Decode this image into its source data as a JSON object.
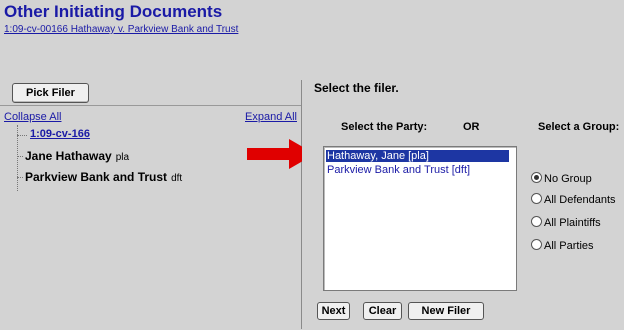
{
  "header": {
    "title": "Other Initiating Documents",
    "case_link": "1:09-cv-00166 Hathaway v. Parkview Bank and Trust"
  },
  "left_panel": {
    "pick_filer_label": "Pick Filer",
    "collapse_all": "Collapse All",
    "expand_all": "Expand All",
    "tree": {
      "case": "1:09-cv-166",
      "parties": [
        {
          "name": "Jane Hathaway",
          "role": "pla"
        },
        {
          "name": "Parkview Bank and Trust",
          "role": "dft"
        }
      ]
    }
  },
  "right_panel": {
    "title": "Select the filer.",
    "party_label": "Select the Party:",
    "or_label": "OR",
    "group_label": "Select a Group:",
    "party_options": [
      "Hathaway, Jane  [pla]",
      "Parkview Bank and Trust  [dft]"
    ],
    "selected_party_index": 0,
    "groups": [
      "No Group",
      "All Defendants",
      "All Plaintiffs",
      "All Parties"
    ],
    "selected_group": "No Group",
    "buttons": {
      "next": "Next",
      "clear": "Clear",
      "new_filer": "New Filer"
    }
  },
  "colors": {
    "link": "#1a1aa6",
    "selection": "#1d36a3",
    "arrow": "#e00000",
    "background": "#d3d3d3"
  }
}
